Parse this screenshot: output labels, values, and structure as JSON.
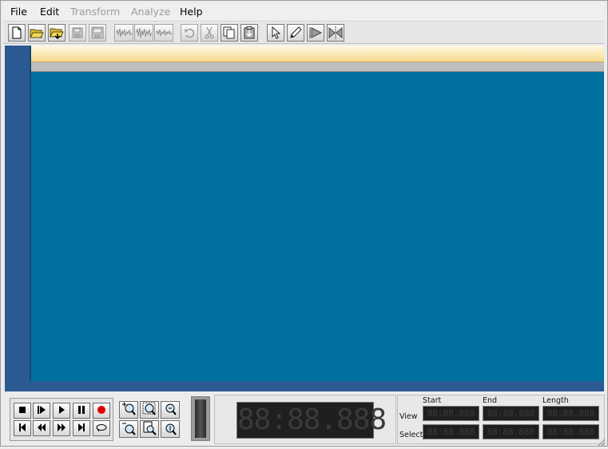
{
  "menu": {
    "items": [
      {
        "label": "File",
        "enabled": true
      },
      {
        "label": "Edit",
        "enabled": true
      },
      {
        "label": "Transform",
        "enabled": false
      },
      {
        "label": "Analyze",
        "enabled": false
      },
      {
        "label": "Help",
        "enabled": true
      }
    ]
  },
  "toolbar": {
    "buttons": [
      "new-file-icon",
      "open-file-icon",
      "open-url-icon",
      "save-icon",
      "save-as-icon",
      "waveform-1-icon",
      "waveform-2-icon",
      "waveform-3-icon",
      "undo-icon",
      "cut-icon",
      "copy-icon",
      "paste-icon",
      "select-tool-icon",
      "pencil-tool-icon",
      "trim-icon",
      "split-icon"
    ]
  },
  "display": {
    "main_counter": "88:88.888"
  },
  "time_panel": {
    "start_label": "Start",
    "end_label": "End",
    "length_label": "Length",
    "view_label": "View",
    "select_label": "Select",
    "view_start": "88:88.888",
    "view_end": "88:88.888",
    "view_length": "88:88.888",
    "select_start": "88:88.888",
    "select_end": "88:88.888",
    "select_length": "88:88.888"
  },
  "colors": {
    "main_background": "#00709e",
    "side_strip": "#2b5a93",
    "timeline": "#f6d98c",
    "lcd_background": "#1f1f1f",
    "record_red": "#e00000"
  }
}
